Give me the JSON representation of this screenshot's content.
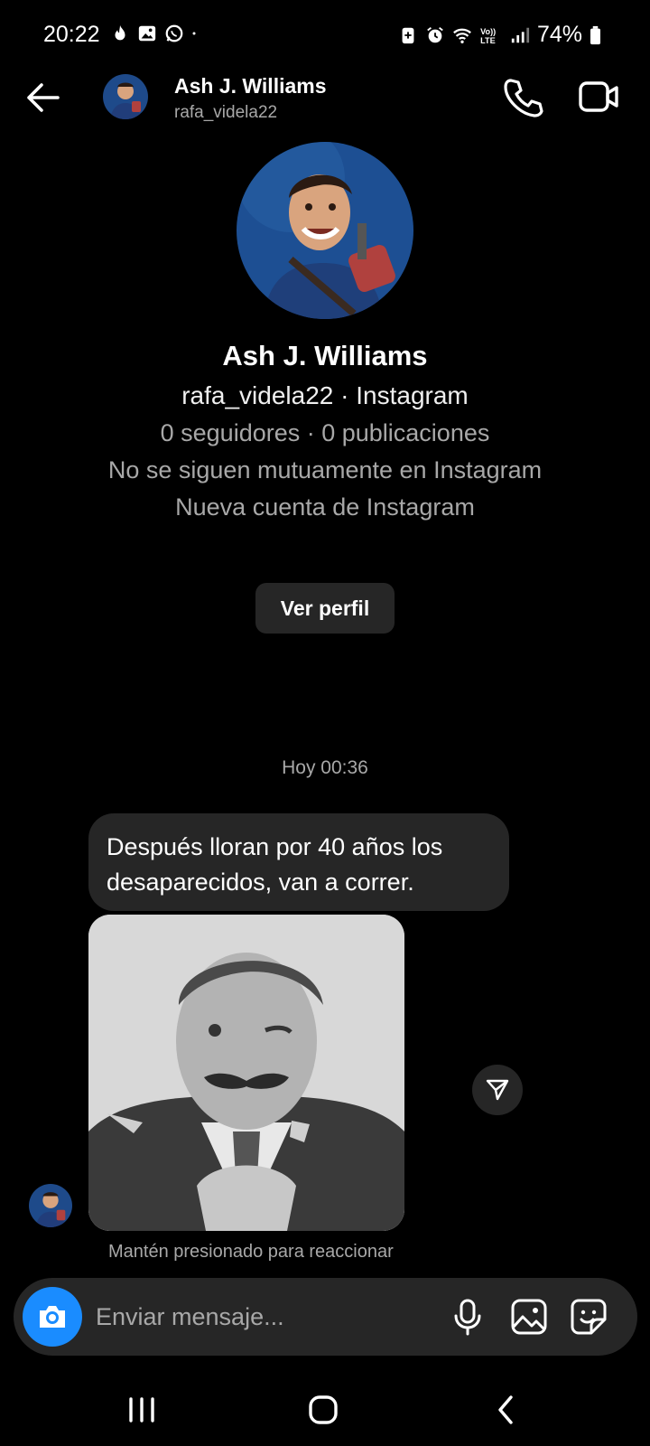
{
  "status_bar": {
    "time": "20:22",
    "battery": "74%",
    "left_icons": [
      "fire-icon",
      "image-icon",
      "whatsapp-icon",
      "dot-icon"
    ],
    "right_icons": [
      "battery-saver-icon",
      "alarm-icon",
      "wifi-icon",
      "volte-icon",
      "signal-icon",
      "battery-icon"
    ]
  },
  "header": {
    "name": "Ash J. Williams",
    "username": "rafa_videla22"
  },
  "profile": {
    "name": "Ash J. Williams",
    "handle_line": "rafa_videla22 · Instagram",
    "stats_line": "0 seguidores · 0 publicaciones",
    "mutual_line": "No se siguen mutuamente en Instagram",
    "new_account_line": "Nueva cuenta de Instagram",
    "view_profile_label": "Ver perfil"
  },
  "chat": {
    "timestamp": "Hoy 00:36",
    "message_text": "Después lloran por 40 años los desaparecidos, van a correr.",
    "hint": "Mantén presionado para reaccionar"
  },
  "composer": {
    "placeholder": "Enviar mensaje..."
  },
  "colors": {
    "background": "#000000",
    "bubble": "#262626",
    "secondary_text": "#a8a8a8",
    "camera_button": "#1a8cff"
  }
}
